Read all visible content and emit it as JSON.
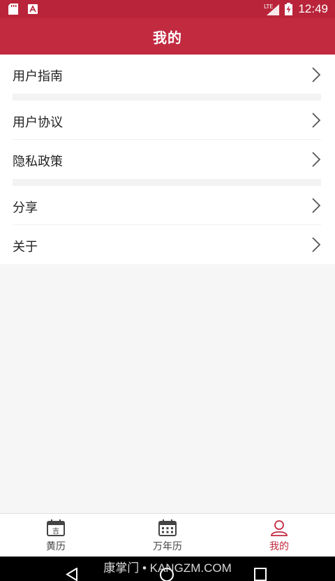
{
  "status_bar": {
    "time": "12:49",
    "network": "LTE"
  },
  "app_bar": {
    "title": "我的"
  },
  "menu_items": [
    {
      "label": "用户指南"
    },
    {
      "label": "用户协议"
    },
    {
      "label": "隐私政策"
    },
    {
      "label": "分享"
    },
    {
      "label": "关于"
    }
  ],
  "bottom_nav": {
    "tabs": [
      {
        "label": "黄历",
        "icon_char": "吉"
      },
      {
        "label": "万年历"
      },
      {
        "label": "我的"
      }
    ],
    "active_color": "#c22a40"
  },
  "watermark": "康掌门 • KANGZM.COM",
  "colors": {
    "status_bar": "#b9243a",
    "app_bar": "#c22a40",
    "background": "#f6f6f6"
  }
}
